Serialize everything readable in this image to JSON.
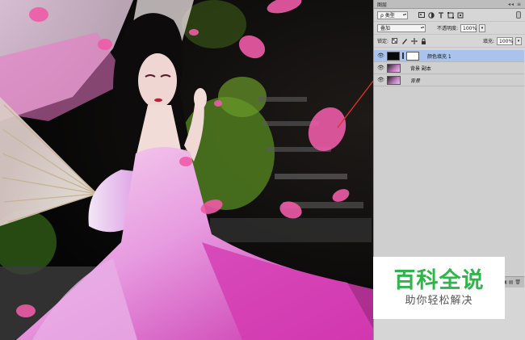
{
  "layers_panel": {
    "title_tab": "图层",
    "panel_controls": "◂◂ ≡",
    "filter": {
      "search_icon": "ρ",
      "kind": "类型"
    },
    "filter_icons": [
      "image-filter-icon",
      "adjustment-filter-icon",
      "type-filter-icon",
      "shape-filter-icon",
      "smart-object-filter-icon",
      "toggle-filter-icon"
    ],
    "blend_mode": "叠加",
    "opacity_label": "不透明度:",
    "opacity_value": "100%",
    "lock_label": "锁定:",
    "fill_label": "填充:",
    "fill_value": "100%",
    "layers": [
      {
        "name": "颜色填充 1",
        "active": true,
        "italic": false
      },
      {
        "name": "背景 副本",
        "active": false,
        "italic": false
      },
      {
        "name": "背景",
        "active": false,
        "italic": true
      }
    ],
    "bottom_icons": "∞  fx  ◐  ▣  ▤  🗑"
  },
  "watermark": {
    "title": "百科全说",
    "subtitle": "助你轻松解决"
  },
  "colors": {
    "panel_bg": "#d6d6d6",
    "active_layer": "#a9c3ec",
    "watermark_green": "#2fb54a",
    "arrow_red": "#d8312a"
  }
}
